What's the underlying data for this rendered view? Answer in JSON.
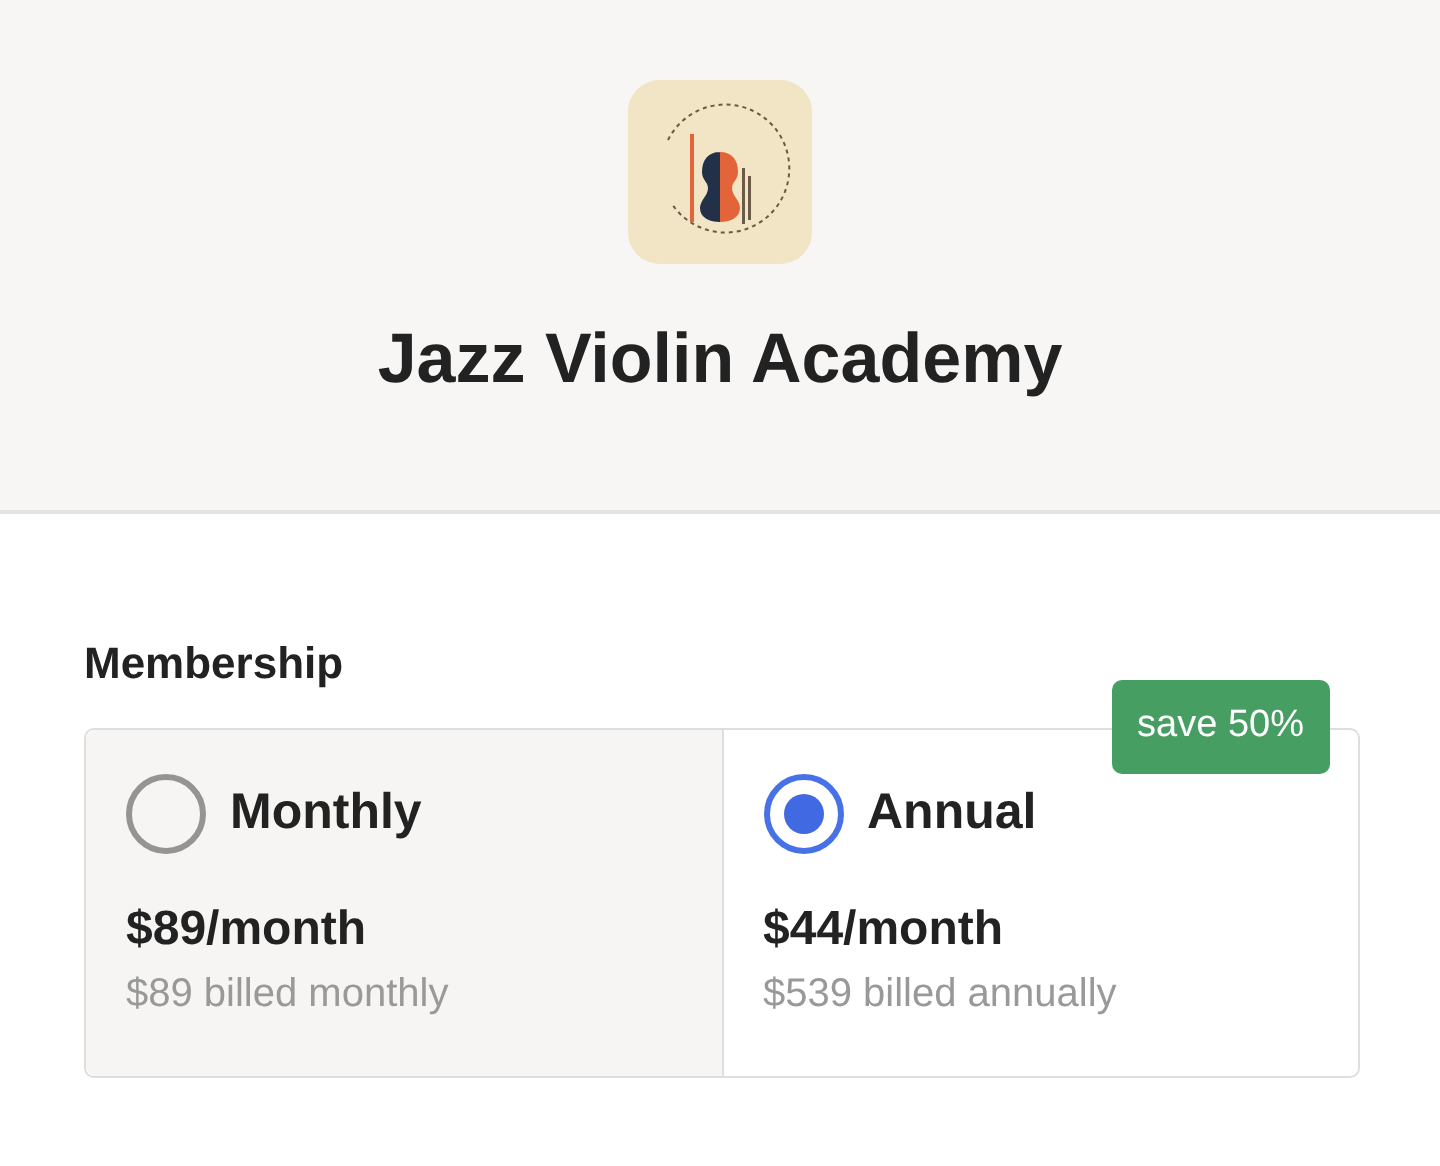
{
  "header": {
    "title": "Jazz Violin Academy"
  },
  "membership": {
    "heading": "Membership",
    "options": [
      {
        "label": "Monthly",
        "selected": false,
        "price": "$89/month",
        "billing": "$89 billed monthly"
      },
      {
        "label": "Annual",
        "selected": true,
        "price": "$44/month",
        "billing": "$539 billed annually",
        "badge": "save 50%"
      }
    ]
  }
}
